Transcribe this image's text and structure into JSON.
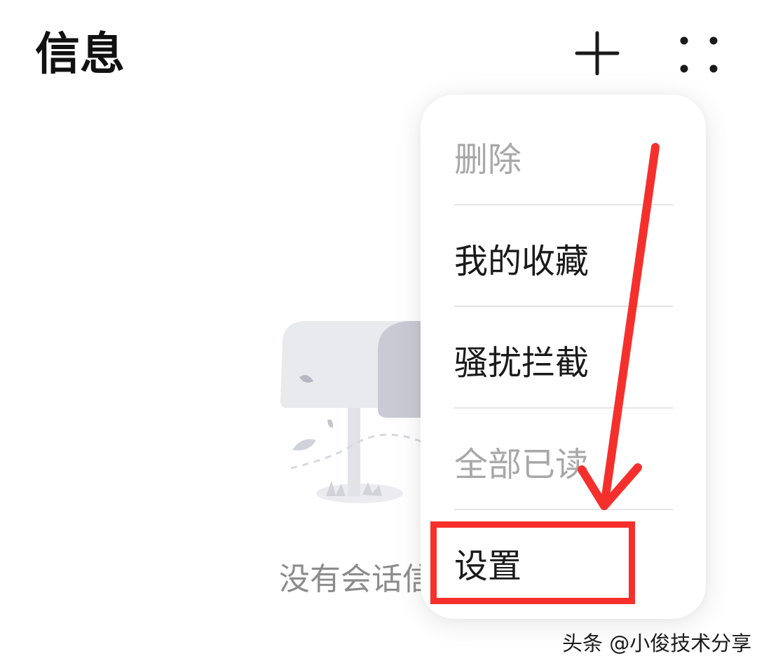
{
  "header": {
    "title": "信息",
    "add_icon": "plus-icon",
    "more_icon": "four-dots-icon"
  },
  "empty_state": {
    "illustration": "mailbox-illustration",
    "text": "没有会话信息"
  },
  "menu": {
    "items": [
      {
        "label": "删除",
        "enabled": false
      },
      {
        "label": "我的收藏",
        "enabled": true
      },
      {
        "label": "骚扰拦截",
        "enabled": true
      },
      {
        "label": "全部已读",
        "enabled": false
      },
      {
        "label": "设置",
        "enabled": true
      }
    ]
  },
  "annotation": {
    "highlight_color": "#f5302c",
    "arrow_color": "#f5302c",
    "target": "设置"
  },
  "watermark": {
    "text": "头条 @小俊技术分享"
  }
}
